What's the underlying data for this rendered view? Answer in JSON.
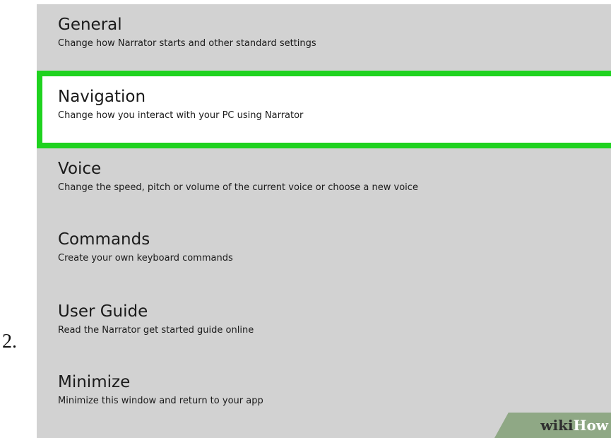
{
  "step_number": "2.",
  "menu": {
    "items": [
      {
        "title": "General",
        "description": "Change how Narrator starts and other standard settings"
      },
      {
        "title": "Navigation",
        "description": "Change how you interact with your PC using Narrator"
      },
      {
        "title": "Voice",
        "description": "Change the speed, pitch or volume of the current voice or choose a new voice"
      },
      {
        "title": "Commands",
        "description": "Create your own keyboard commands"
      },
      {
        "title": "User Guide",
        "description": "Read the Narrator get started guide online"
      },
      {
        "title": "Minimize",
        "description": "Minimize this window and return to your app"
      }
    ],
    "highlighted_index": 1
  },
  "watermark": {
    "wiki": "wiki",
    "how": "How"
  },
  "colors": {
    "panel_background": "#d2d2d2",
    "highlight_border": "#1fd21f",
    "highlight_background": "#ffffff",
    "watermark_background": "#8fa885"
  }
}
